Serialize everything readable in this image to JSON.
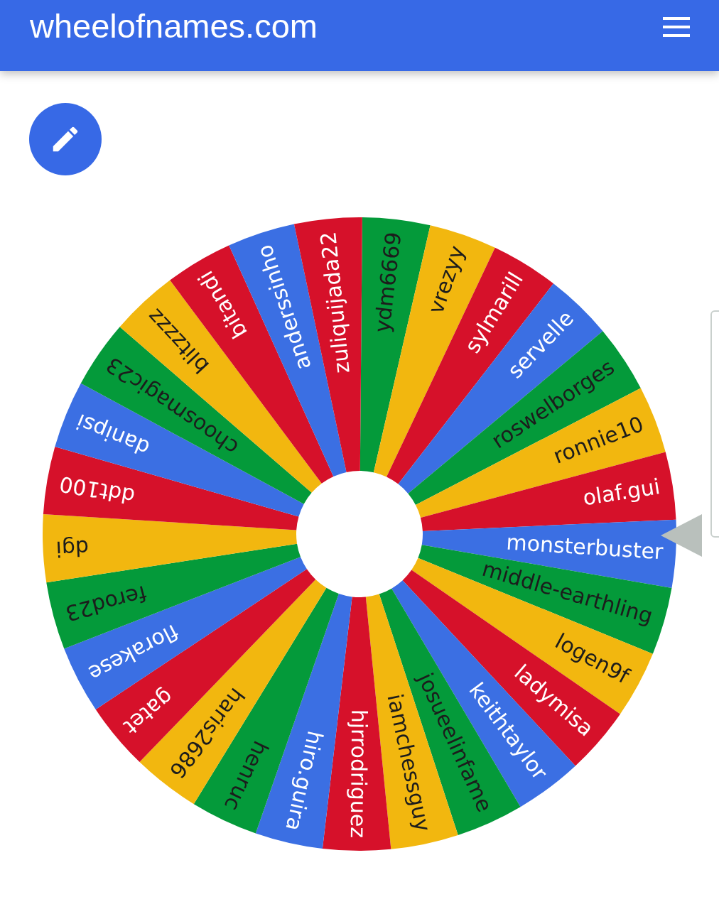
{
  "header": {
    "title": "wheelofnames.com"
  },
  "wheel": {
    "names": [
      {
        "label": "ydm6669",
        "color": "#049a3a"
      },
      {
        "label": "vrezyy",
        "color": "#f2b70f"
      },
      {
        "label": "sylmarill",
        "color": "#d6112a"
      },
      {
        "label": "servelle",
        "color": "#3b6fe3"
      },
      {
        "label": "roswelborges",
        "color": "#049a3a"
      },
      {
        "label": "ronnie10",
        "color": "#f2b70f"
      },
      {
        "label": "olaf.gui",
        "color": "#d6112a"
      },
      {
        "label": "monsterbuster",
        "color": "#3b6fe3"
      },
      {
        "label": "middle-earthling",
        "color": "#049a3a"
      },
      {
        "label": "logen9f",
        "color": "#f2b70f"
      },
      {
        "label": "ladymisa",
        "color": "#d6112a"
      },
      {
        "label": "keithtaylor",
        "color": "#3b6fe3"
      },
      {
        "label": "josueelinfame",
        "color": "#049a3a"
      },
      {
        "label": "iamchessguy",
        "color": "#f2b70f"
      },
      {
        "label": "hjrrodriguez",
        "color": "#d6112a"
      },
      {
        "label": "hiro.guira",
        "color": "#3b6fe3"
      },
      {
        "label": "henruc",
        "color": "#049a3a"
      },
      {
        "label": "haris2686",
        "color": "#f2b70f"
      },
      {
        "label": "gatet",
        "color": "#d6112a"
      },
      {
        "label": "florakese",
        "color": "#3b6fe3"
      },
      {
        "label": "ferod23",
        "color": "#049a3a"
      },
      {
        "label": "dgi",
        "color": "#f2b70f"
      },
      {
        "label": "ddt100",
        "color": "#d6112a"
      },
      {
        "label": "danipsi",
        "color": "#3b6fe3"
      },
      {
        "label": "choosmagic23",
        "color": "#049a3a"
      },
      {
        "label": "blitzzzz",
        "color": "#f2b70f"
      },
      {
        "label": "bitandi",
        "color": "#d6112a"
      },
      {
        "label": "anderssinho",
        "color": "#3b6fe3"
      },
      {
        "label": "zuliquijada22",
        "color": "#d6112a"
      }
    ]
  }
}
